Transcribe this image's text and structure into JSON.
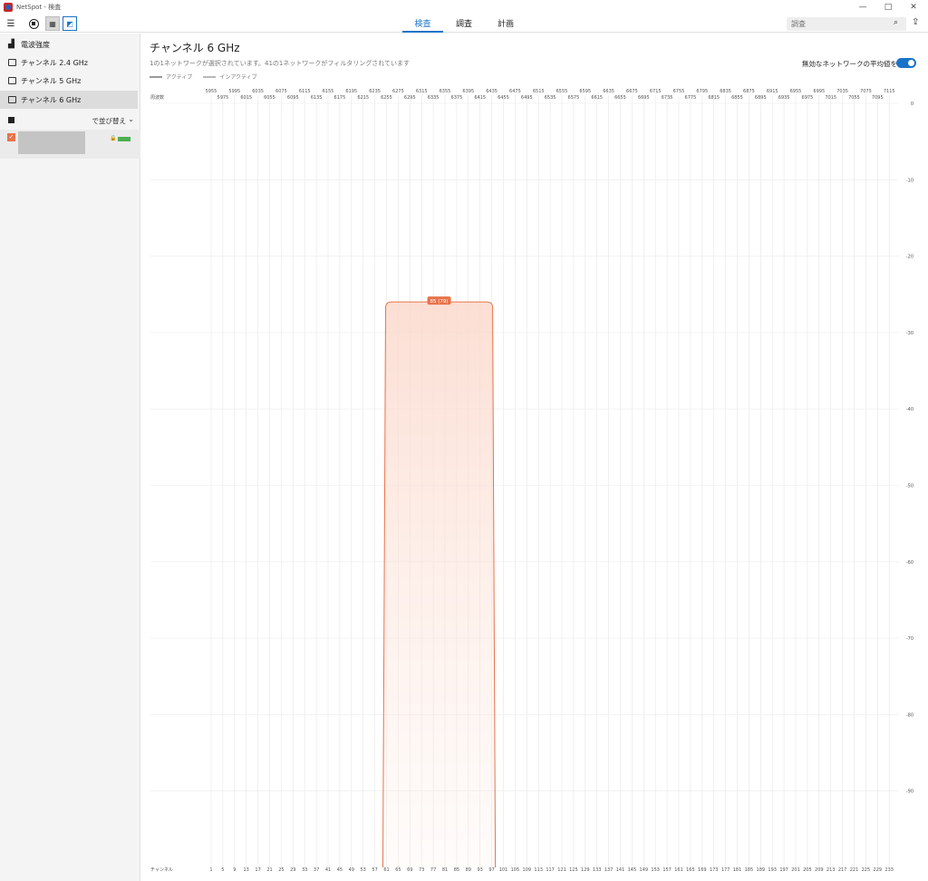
{
  "window": {
    "title": "NetSpot - 検査",
    "controls": [
      "—",
      "□",
      "✕"
    ]
  },
  "toolbar": {
    "menu_icon": "menu-icon",
    "tabs": [
      {
        "label": "検査",
        "active": true
      },
      {
        "label": "調査",
        "active": false
      },
      {
        "label": "計画",
        "active": false
      }
    ],
    "search_placeholder": "調査",
    "accent": "#1a73c9"
  },
  "sidebar": {
    "items": [
      {
        "label": "電波強度",
        "icon": "signal-bars-icon",
        "active": false
      },
      {
        "label": "チャンネル 2.4 GHz",
        "icon": "channel-icon",
        "active": false
      },
      {
        "label": "チャンネル 5 GHz",
        "icon": "channel-icon",
        "active": false
      },
      {
        "label": "チャンネル 6 GHz",
        "icon": "channel-icon",
        "active": true
      }
    ],
    "sort_label": "で並び替え",
    "network": {
      "checked": true,
      "color": "#e8734a",
      "signal_color": "#4caf50"
    }
  },
  "main": {
    "title": "チャンネル 6 GHz",
    "subtitle": "1の1ネットワークが選択されています。41の1ネットワークがフィルタリングされています",
    "legend_active": "アクティブ",
    "legend_inactive": "インアクティブ",
    "toggle_label": "無効なネットワークの平均値を表示",
    "toggle_on": true
  },
  "chart_data": {
    "type": "area",
    "freq_label": "周波数",
    "channel_label": "チャンネル",
    "freq_ticks_top": [
      "5955",
      "5995",
      "6035",
      "6075",
      "6115",
      "6155",
      "6195",
      "6235",
      "6275",
      "6315",
      "6355",
      "6395",
      "6435",
      "6475",
      "6515",
      "6555",
      "6595",
      "6635",
      "6675",
      "6715",
      "6755",
      "6795",
      "6835",
      "6875",
      "6915",
      "6955",
      "6995",
      "7035",
      "7075",
      "7115"
    ],
    "freq_ticks_bottom": [
      "5975",
      "6015",
      "6055",
      "6095",
      "6135",
      "6175",
      "6215",
      "6255",
      "6295",
      "6335",
      "6375",
      "6415",
      "6455",
      "6495",
      "6535",
      "6575",
      "6615",
      "6655",
      "6695",
      "6735",
      "6775",
      "6815",
      "6855",
      "6895",
      "6935",
      "6975",
      "7015",
      "7055",
      "7095"
    ],
    "channels": [
      "1",
      "5",
      "9",
      "13",
      "17",
      "21",
      "25",
      "29",
      "33",
      "37",
      "41",
      "45",
      "49",
      "53",
      "57",
      "61",
      "65",
      "69",
      "73",
      "77",
      "81",
      "85",
      "89",
      "93",
      "97",
      "101",
      "105",
      "109",
      "113",
      "117",
      "121",
      "125",
      "129",
      "133",
      "137",
      "141",
      "145",
      "149",
      "153",
      "157",
      "161",
      "165",
      "169",
      "173",
      "177",
      "181",
      "185",
      "189",
      "193",
      "197",
      "201",
      "205",
      "209",
      "213",
      "217",
      "221",
      "225",
      "229",
      "233"
    ],
    "y_ticks": [
      "0",
      "-10",
      "-20",
      "-30",
      "-40",
      "-50",
      "-60",
      "-70",
      "-80",
      "-90"
    ],
    "ylim": [
      -100,
      0
    ],
    "networks": [
      {
        "label": "85 (79)",
        "channel_from": 61,
        "channel_to": 97,
        "level": -26,
        "color": "#e8734a"
      }
    ]
  }
}
